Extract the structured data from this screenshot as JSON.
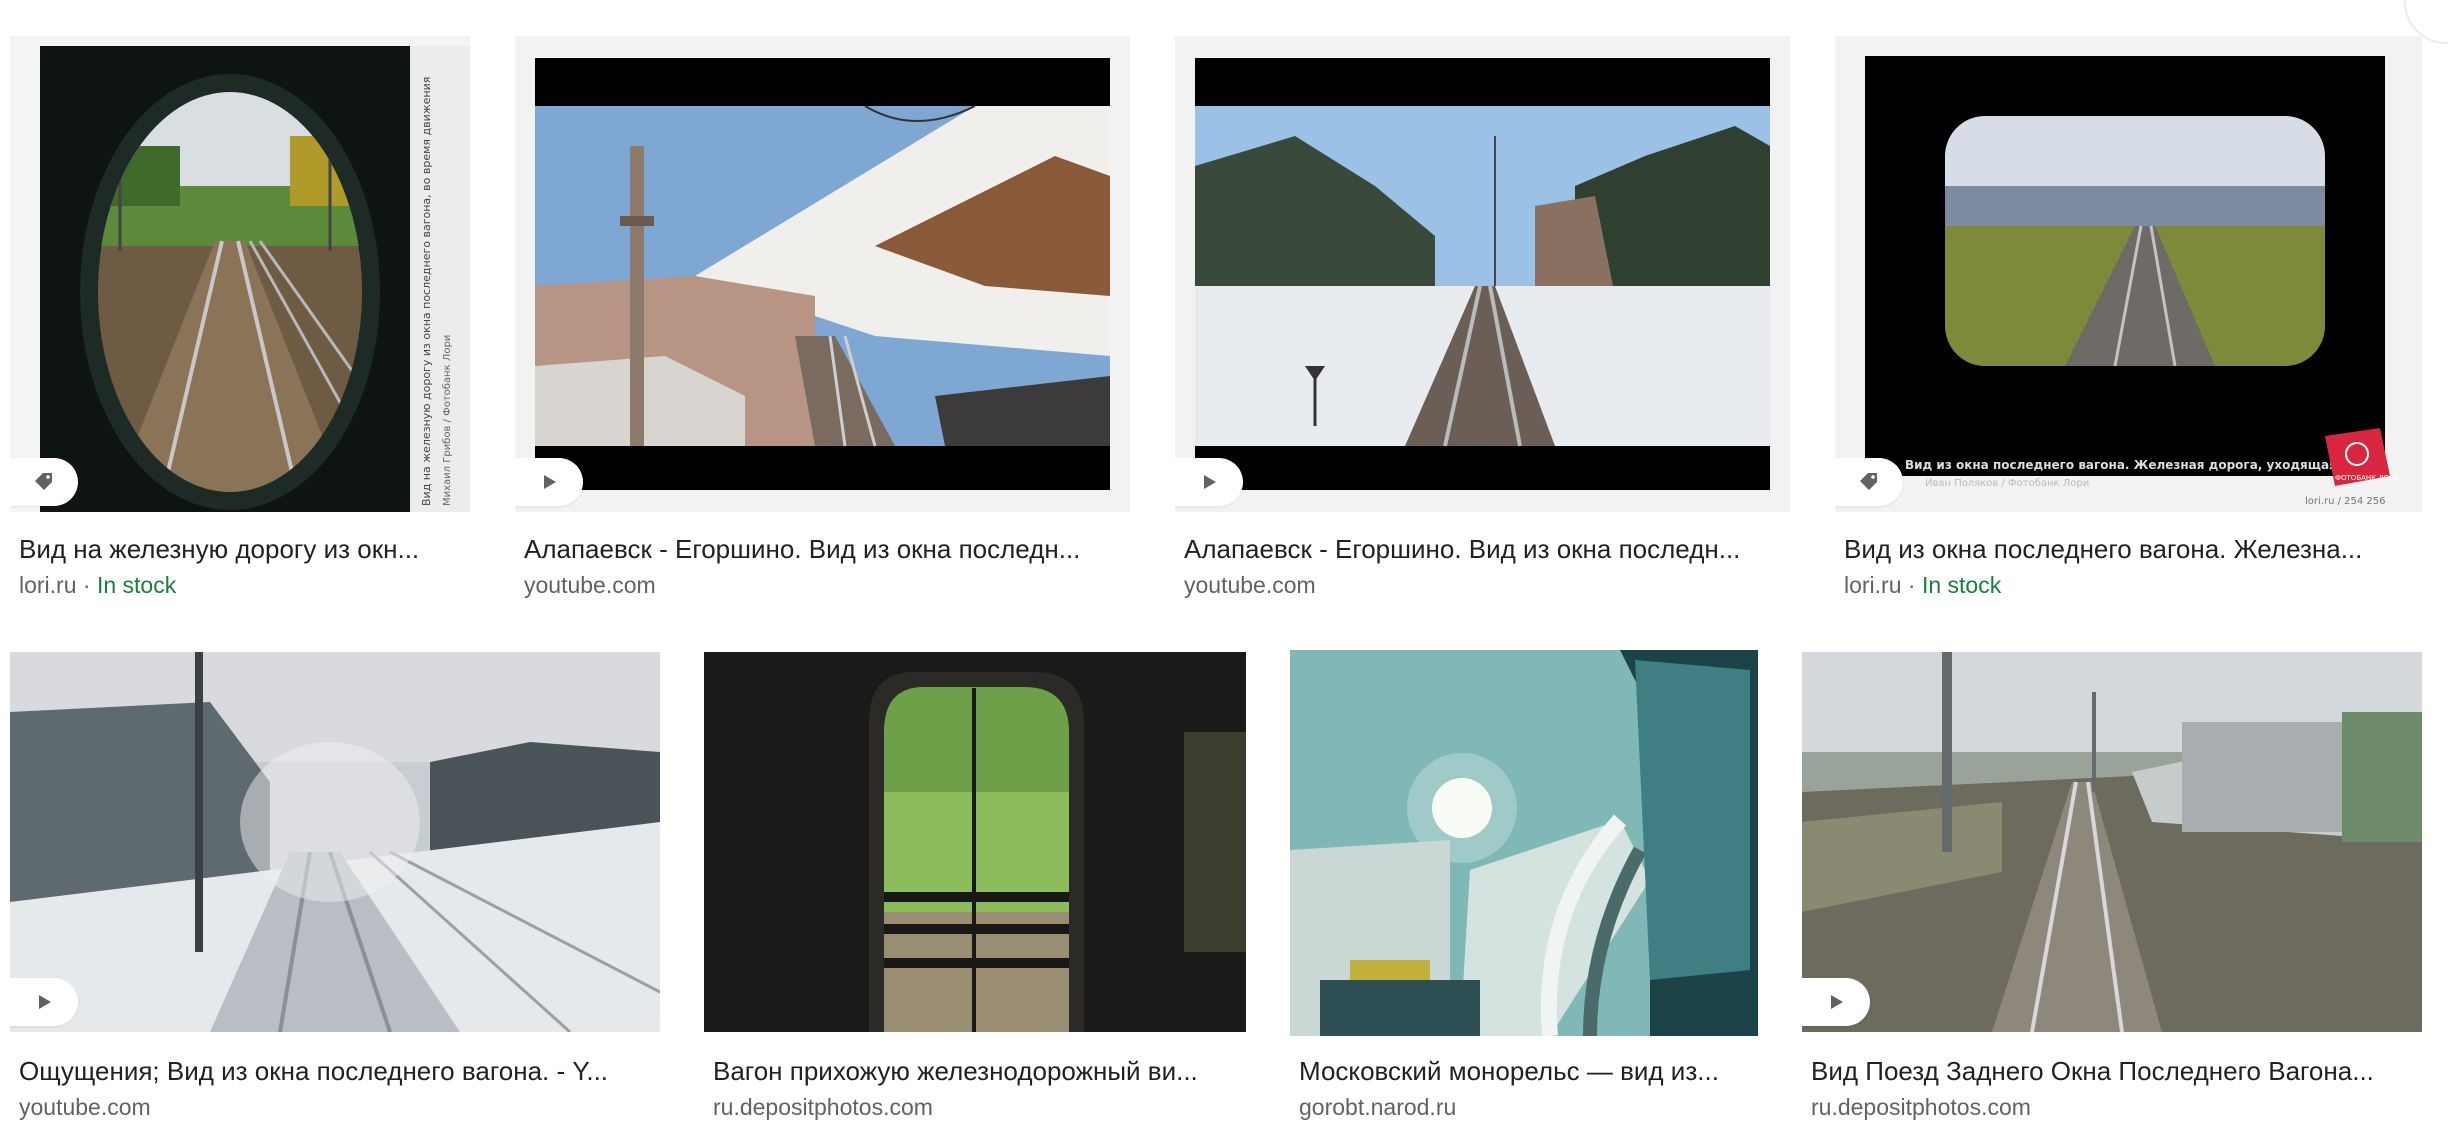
{
  "results": [
    {
      "title": "Вид на железную дорогу из окн...",
      "source": "lori.ru",
      "separator": " · ",
      "stock": "In stock",
      "badge": "tag-icon",
      "thumb_caption": "Вид на железную дорогу из окна последнего вагона, во время движения",
      "thumb_credit": "Михаил Грибов / Фотобанк Лори"
    },
    {
      "title": "Алапаевск - Егоршино. Вид из окна последн...",
      "source": "youtube.com",
      "badge": "play-icon"
    },
    {
      "title": "Алапаевск - Егоршино. Вид из окна последн...",
      "source": "youtube.com",
      "badge": "play-icon"
    },
    {
      "title": "Вид из окна последнего вагона. Железна...",
      "source": "lori.ru",
      "separator": " · ",
      "stock": "In stock",
      "badge": "tag-icon",
      "thumb_caption": "Вид из окна последнего вагона. Железная дорога, уходящая вдаль",
      "thumb_credit": "Иван Поляков / Фотобанк Лори",
      "thumb_id": "lori.ru / 254 256",
      "watermark": "ФОТОБАНК ЛОРИ"
    },
    {
      "title": "Ощущения; Вид из окна последнего вагона. - Y...",
      "source": "youtube.com",
      "badge": "play-icon"
    },
    {
      "title": "Вагон прихожую железнодорожный ви...",
      "source": "ru.depositphotos.com"
    },
    {
      "title": "Московский монорельс — вид из...",
      "source": "gorobt.narod.ru"
    },
    {
      "title": "Вид Поезд Заднего Окна Последнего Вагона...",
      "source": "ru.depositphotos.com",
      "badge": "play-icon"
    }
  ],
  "colors": {
    "title": "#202124",
    "source": "#5f6368",
    "stock": "#188038",
    "thumb_bg": "#f2f2f2"
  }
}
